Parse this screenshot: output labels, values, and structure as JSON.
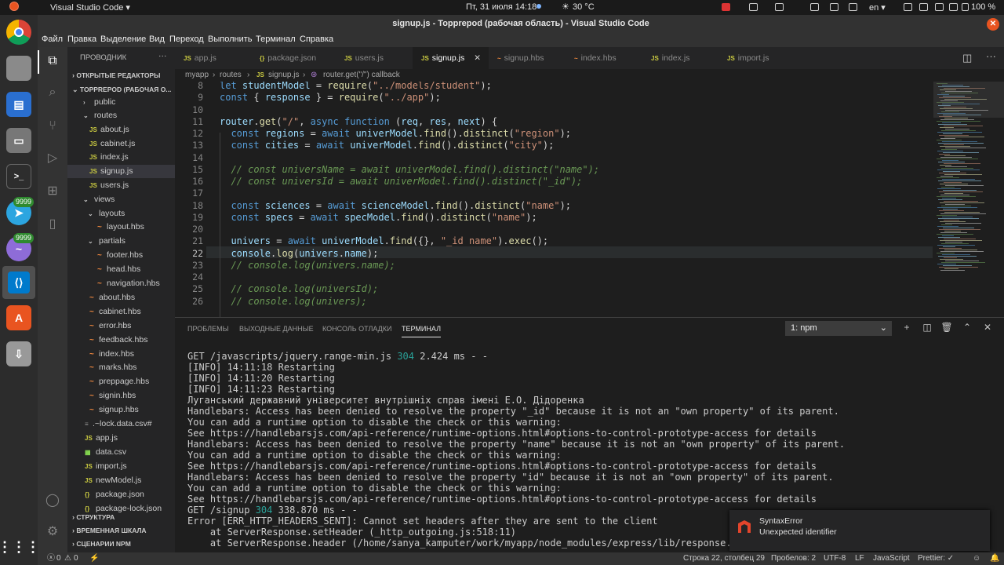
{
  "topbar": {
    "activities": "",
    "app": "Visual Studio Code ▾",
    "clock": "Пт, 31 июля  14:18",
    "weather": "30 °C",
    "lang": "en ▾",
    "battery": "100 %"
  },
  "dock": {
    "badge1": "9999",
    "badge2": "9999"
  },
  "window": {
    "title": "signup.js - Topprepod (рабочая область) - Visual Studio Code"
  },
  "menu": [
    "Файл",
    "Правка",
    "Выделение",
    "Вид",
    "Переход",
    "Выполнить",
    "Терминал",
    "Справка"
  ],
  "sidebar": {
    "header": "ПРОВОДНИК",
    "open_editors": "ОТКРЫТЫЕ РЕДАКТОРЫ",
    "workspace": "TOPPREPOD (РАБОЧАЯ О...",
    "tree": [
      {
        "label": "public",
        "type": "folder",
        "depth": 1,
        "chev": "›"
      },
      {
        "label": "routes",
        "type": "folder",
        "depth": 1,
        "chev": "⌄"
      },
      {
        "label": "about.js",
        "type": "js",
        "depth": 2
      },
      {
        "label": "cabinet.js",
        "type": "js",
        "depth": 2
      },
      {
        "label": "index.js",
        "type": "js",
        "depth": 2
      },
      {
        "label": "signup.js",
        "type": "js",
        "depth": 2,
        "selected": true
      },
      {
        "label": "users.js",
        "type": "js",
        "depth": 2
      },
      {
        "label": "views",
        "type": "folder",
        "depth": 1,
        "chev": "⌄"
      },
      {
        "label": "layouts",
        "type": "folder",
        "depth": 2,
        "chev": "⌄"
      },
      {
        "label": "layout.hbs",
        "type": "hbs",
        "depth": 3
      },
      {
        "label": "partials",
        "type": "folder",
        "depth": 2,
        "chev": "⌄"
      },
      {
        "label": "footer.hbs",
        "type": "hbs",
        "depth": 3
      },
      {
        "label": "head.hbs",
        "type": "hbs",
        "depth": 3
      },
      {
        "label": "navigation.hbs",
        "type": "hbs",
        "depth": 3
      },
      {
        "label": "about.hbs",
        "type": "hbs",
        "depth": 2
      },
      {
        "label": "cabinet.hbs",
        "type": "hbs",
        "depth": 2
      },
      {
        "label": "error.hbs",
        "type": "hbs",
        "depth": 2
      },
      {
        "label": "feedback.hbs",
        "type": "hbs",
        "depth": 2
      },
      {
        "label": "index.hbs",
        "type": "hbs",
        "depth": 2
      },
      {
        "label": "marks.hbs",
        "type": "hbs",
        "depth": 2
      },
      {
        "label": "preppage.hbs",
        "type": "hbs",
        "depth": 2
      },
      {
        "label": "signin.hbs",
        "type": "hbs",
        "depth": 2
      },
      {
        "label": "signup.hbs",
        "type": "hbs",
        "depth": 2
      },
      {
        "label": ".~lock.data.csv#",
        "type": "file",
        "depth": 1
      },
      {
        "label": "app.js",
        "type": "js",
        "depth": 1
      },
      {
        "label": "data.csv",
        "type": "csv",
        "depth": 1
      },
      {
        "label": "import.js",
        "type": "js",
        "depth": 1
      },
      {
        "label": "newModel.js",
        "type": "js",
        "depth": 1
      },
      {
        "label": "package.json",
        "type": "json",
        "depth": 1
      },
      {
        "label": "package-lock.json",
        "type": "json",
        "depth": 1
      }
    ],
    "outline": "СТРУКТУРА",
    "timeline": "ВРЕМЕННАЯ ШКАЛА",
    "npm": "СЦЕНАРИИ NPM"
  },
  "tabs": [
    {
      "label": "app.js",
      "icon": "JS"
    },
    {
      "label": "package.json",
      "icon": "{}"
    },
    {
      "label": "users.js",
      "icon": "JS"
    },
    {
      "label": "signup.js",
      "icon": "JS",
      "active": true
    },
    {
      "label": "signup.hbs",
      "icon": "~"
    },
    {
      "label": "index.hbs",
      "icon": "~"
    },
    {
      "label": "index.js",
      "icon": "JS"
    },
    {
      "label": "import.js",
      "icon": "JS"
    }
  ],
  "breadcrumb": [
    "myapp",
    "routes",
    "signup.js",
    "router.get(\"/\") callback"
  ],
  "editor": {
    "line_numbers": [
      "8",
      "9",
      "10",
      "11",
      "12",
      "13",
      "14",
      "15",
      "16",
      "17",
      "18",
      "19",
      "20",
      "21",
      "22",
      "23",
      "24",
      "25",
      "26"
    ],
    "lines": [
      "let studentModel = require(\"../models/student\");",
      "const { response } = require(\"../app\");",
      "",
      "router.get(\"/\", async function (req, res, next) {",
      "  const regions = await univerModel.find().distinct(\"region\");",
      "  const cities = await univerModel.find().distinct(\"city\");",
      "",
      "  // const universName = await univerModel.find().distinct(\"name\");",
      "  // const universId = await univerModel.find().distinct(\"_id\");",
      "",
      "  const sciences = await scienceModel.find().distinct(\"name\");",
      "  const specs = await specModel.find().distinct(\"name\");",
      "",
      "  univers = await univerModel.find({}, \"_id name\").exec();",
      "  console.log(univers.name);",
      "  // console.log(univers.name);",
      "",
      "  // console.log(universId);",
      "  // console.log(univers);"
    ]
  },
  "panel": {
    "tabs": [
      "ПРОБЛЕМЫ",
      "ВЫХОДНЫЕ ДАННЫЕ",
      "КОНСОЛЬ ОТЛАДКИ",
      "ТЕРМИНАЛ"
    ],
    "terminal_select": "1: npm",
    "terminal": [
      "GET /javascripts/jquery.range-min.js 304 2.424 ms - -",
      "[INFO] 14:11:18 Restarting",
      "[INFO] 14:11:20 Restarting",
      "[INFO] 14:11:23 Restarting",
      "Луганський державний університет внутрішніх справ імені Е.О. Дідоренка",
      "Handlebars: Access has been denied to resolve the property \"_id\" because it is not an \"own property\" of its parent.",
      "You can add a runtime option to disable the check or this warning:",
      "See https://handlebarsjs.com/api-reference/runtime-options.html#options-to-control-prototype-access for details",
      "Handlebars: Access has been denied to resolve the property \"name\" because it is not an \"own property\" of its parent.",
      "You can add a runtime option to disable the check or this warning:",
      "See https://handlebarsjs.com/api-reference/runtime-options.html#options-to-control-prototype-access for details",
      "Handlebars: Access has been denied to resolve the property \"id\" because it is not an \"own property\" of its parent.",
      "You can add a runtime option to disable the check or this warning:",
      "See https://handlebarsjs.com/api-reference/runtime-options.html#options-to-control-prototype-access for details",
      "GET /signup 304 338.870 ms - -",
      "Error [ERR_HTTP_HEADERS_SENT]: Cannot set headers after they are sent to the client",
      "    at ServerResponse.setHeader (_http_outgoing.js:518:11)",
      "    at ServerResponse.header (/home/sanya_kamputer/work/myapp/node_modules/express/lib/response.js:771:10)"
    ]
  },
  "toast": {
    "title": "SyntaxError",
    "message": "Unexpected identifier"
  },
  "statusbar": {
    "errors": "0",
    "warnings": "0",
    "position": "Строка 22, столбец 29",
    "spaces": "Пробелов: 2",
    "encoding": "UTF-8",
    "eol": "LF",
    "language": "JavaScript",
    "prettier": "Prettier: ✓"
  },
  "colors": {
    "accent": "#007acc",
    "statusbar": "#333333",
    "editor_bg": "#1e1e1e"
  }
}
